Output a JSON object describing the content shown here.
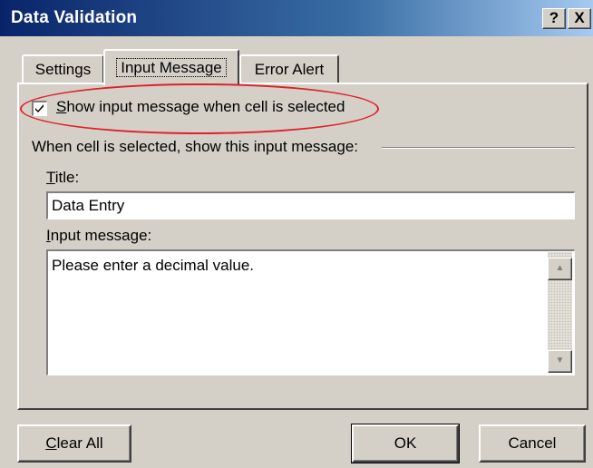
{
  "window": {
    "title": "Data Validation",
    "help_button": "?",
    "close_button": "X"
  },
  "tabs": [
    {
      "label": "Settings",
      "active": false
    },
    {
      "label": "Input Message",
      "active": true
    },
    {
      "label": "Error Alert",
      "active": false
    }
  ],
  "show_message": {
    "checked": true,
    "accel": "S",
    "label_rest": "how input message when cell is selected"
  },
  "group_label": "When cell is selected, show this input message:",
  "title_field": {
    "label_accel": "T",
    "label_rest": "itle:",
    "value": "Data Entry"
  },
  "message_field": {
    "label_accel": "I",
    "label_rest": "nput message:",
    "value": "Please enter a decimal value."
  },
  "buttons": {
    "clear_accel": "C",
    "clear_rest": "lear All",
    "ok": "OK",
    "cancel": "Cancel"
  },
  "annotation": {
    "highlight_color": "#e0202a"
  },
  "icons": {
    "scroll_up": "scroll-up-arrow-icon",
    "scroll_down": "scroll-down-arrow-icon",
    "checkmark": "checkmark-icon"
  }
}
